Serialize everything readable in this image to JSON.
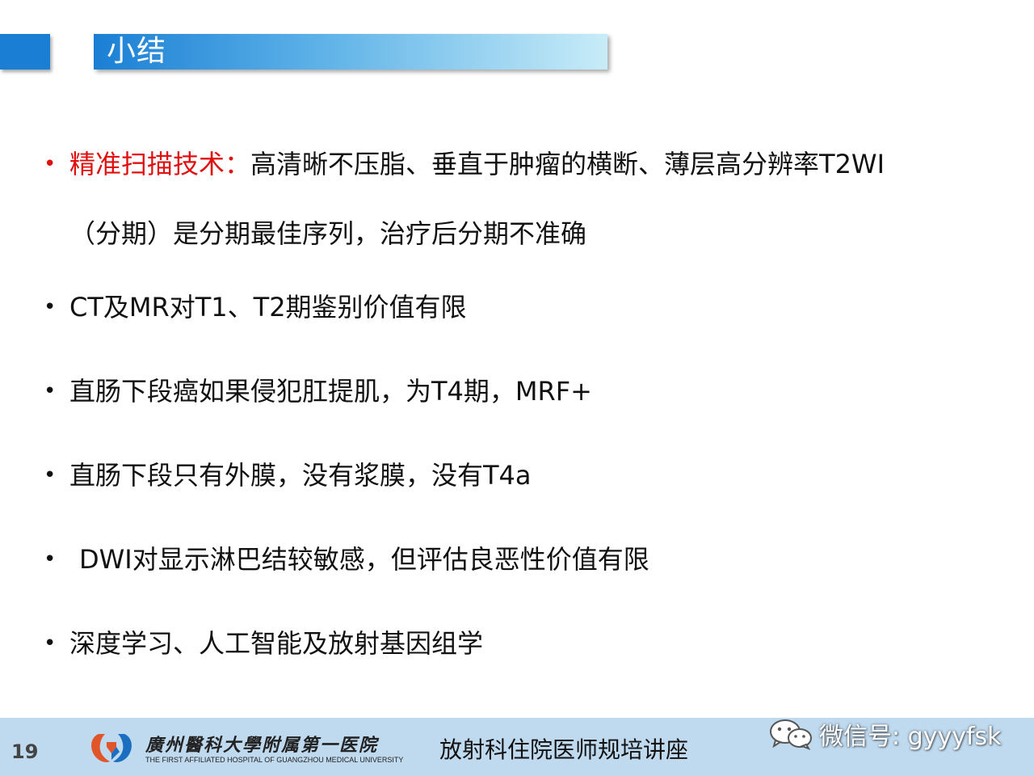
{
  "header": {
    "title": "小结"
  },
  "bullets": [
    {
      "highlight": "精准扫描技术：",
      "text": "高清晰不压脂、垂直于肿瘤的横断、薄层高分辨率T2WI",
      "continuation": "（分期）是分期最佳序列，治疗后分期不准确"
    },
    {
      "text": "CT及MR对T1、T2期鉴别价值有限"
    },
    {
      "text": "直肠下段癌如果侵犯肛提肌，为T4期，MRF+"
    },
    {
      "text": "直肠下段只有外膜，没有浆膜，没有T4a"
    },
    {
      "text": "DWI对显示淋巴结较敏感，但评估良恶性价值有限"
    },
    {
      "text": "深度学习、人工智能及放射基因组学"
    }
  ],
  "bullet_symbol": "•",
  "footer": {
    "page_number": "19",
    "hospital_name_cn": "廣州醫科大學附属第一医院",
    "hospital_name_en": "THE FIRST AFFILIATED HOSPITAL OF GUANGZHOU MEDICAL UNIVERSITY",
    "lecture_title": "放射科住院医师规培讲座",
    "wechat_label": "微信号: gyyyfsk"
  },
  "colors": {
    "accent_blue": "#1a7fd4",
    "highlight_red": "#e01010",
    "footer_bg": "#bfd9ee"
  },
  "icons": {
    "logo": "hospital-logo-icon",
    "wechat": "wechat-icon"
  }
}
